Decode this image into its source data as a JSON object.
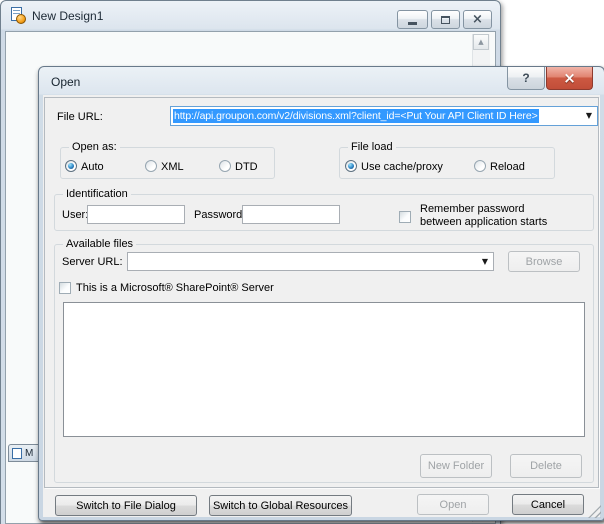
{
  "background_window": {
    "title": "New Design1",
    "minimized_child_title": "M"
  },
  "dialog": {
    "title": "Open",
    "file_url": {
      "label": "File URL:",
      "value": "http://api.groupon.com/v2/divisions.xml?client_id=<Put Your API Client ID Here>"
    },
    "open_as": {
      "legend": "Open as:",
      "options": [
        {
          "label": "Auto",
          "selected": true
        },
        {
          "label": "XML",
          "selected": false
        },
        {
          "label": "DTD",
          "selected": false
        }
      ]
    },
    "file_load": {
      "legend": "File load",
      "options": [
        {
          "label": "Use cache/proxy",
          "selected": true
        },
        {
          "label": "Reload",
          "selected": false
        }
      ]
    },
    "identification": {
      "legend": "Identification",
      "user_label": "User:",
      "user_value": "",
      "password_label": "Password:",
      "password_value": "",
      "remember_checkbox": {
        "checked": false,
        "label_line1": "Remember password",
        "label_line2": "between application starts"
      }
    },
    "available_files": {
      "legend": "Available files",
      "server_url_label": "Server URL:",
      "server_url_value": "",
      "browse_button": "Browse",
      "sharepoint_checkbox": {
        "checked": false,
        "label": "This is a Microsoft® SharePoint® Server"
      },
      "file_list": [],
      "new_folder_button": "New Folder",
      "delete_button": "Delete"
    },
    "footer": {
      "switch_file_dialog_button": "Switch to File Dialog",
      "switch_global_resources_button": "Switch to Global Resources",
      "open_button": "Open",
      "cancel_button": "Cancel"
    }
  },
  "icons": {
    "help_glyph": "?",
    "close_glyph": "×",
    "combo_arrow": "▼",
    "scroll_up_arrow": "▲"
  },
  "colors": {
    "selection_bg": "#3399FF",
    "selection_text": "#FFFFFF",
    "close_button_red": "#CD5942",
    "dialog_face": "#F0F0F0"
  }
}
